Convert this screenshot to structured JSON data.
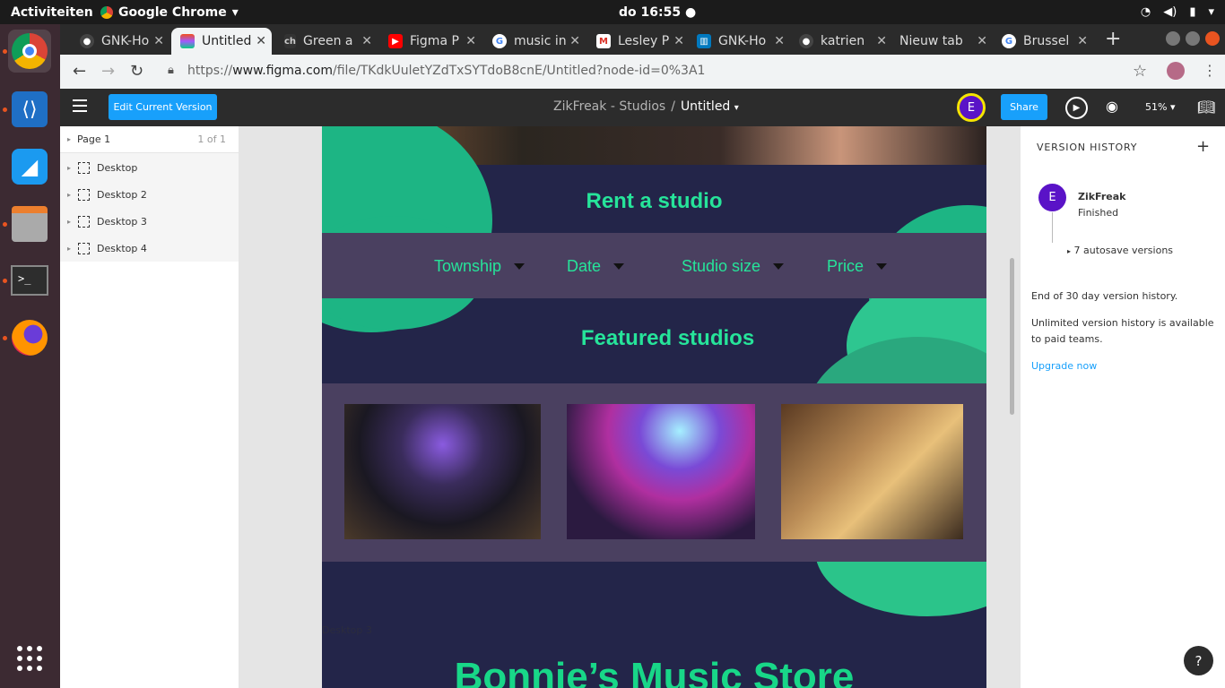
{
  "system": {
    "activities": "Activiteiten",
    "app_name": "Google Chrome",
    "clock": "do 16:55"
  },
  "tabs": [
    {
      "label": "GNK-Ho",
      "icon": "github-icon"
    },
    {
      "label": "Untitled",
      "icon": "figma-icon",
      "active": true
    },
    {
      "label": "Green a",
      "icon": "ch-icon"
    },
    {
      "label": "Figma P",
      "icon": "youtube-icon"
    },
    {
      "label": "music in",
      "icon": "google-icon"
    },
    {
      "label": "Lesley P",
      "icon": "gmail-icon"
    },
    {
      "label": "GNK-Ho",
      "icon": "trello-icon"
    },
    {
      "label": "katrien",
      "icon": "github-icon"
    },
    {
      "label": "Nieuw tab",
      "icon": "none"
    },
    {
      "label": "Brussel",
      "icon": "google-icon"
    }
  ],
  "address": {
    "prefix": "https://",
    "domain": "www.figma.com",
    "path": "/file/TKdkUuletYZdTxSYTdoB8cnE/Untitled?node-id=0%3A1"
  },
  "toolbar": {
    "edit_label": "Edit Current Version",
    "team": "ZikFreak - Studios",
    "separator": "/",
    "file_name": "Untitled",
    "avatar_initial": "E",
    "share_label": "Share",
    "zoom": "51%"
  },
  "layers": {
    "page_name": "Page 1",
    "page_count": "1 of 1",
    "items": [
      "Desktop",
      "Desktop 2",
      "Desktop 3",
      "Desktop 4"
    ]
  },
  "design": {
    "rent_title": "Rent a studio",
    "filters": [
      "Township",
      "Date",
      "Studio size",
      "Price"
    ],
    "featured_title": "Featured studios",
    "frame_label": "Desktop 3",
    "store_title": "Bonnie’s Music Store",
    "accent": "#26e49a",
    "background": "#232549"
  },
  "version_history": {
    "title": "VERSION HISTORY",
    "user_initial": "E",
    "user": "ZikFreak",
    "status": "Finished",
    "autosave": "7 autosave versions",
    "end_note": "End of 30 day version history.",
    "unlimited_note": "Unlimited version history is available to paid teams.",
    "upgrade": "Upgrade now"
  }
}
